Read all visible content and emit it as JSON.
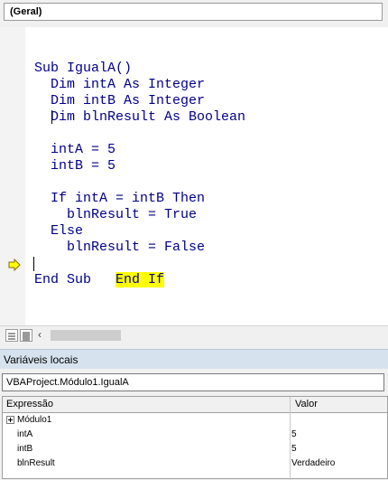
{
  "object_combo": {
    "value": "(Geral)"
  },
  "code": {
    "lines": [
      "Sub IgualA()",
      "  Dim intA As Integer",
      "  Dim intB As Integer",
      "  Dim blnResult As Boolean",
      "",
      "  intA = 5",
      "  intB = 5",
      "",
      "  If intA = intB Then",
      "    blnResult = True",
      "  Else",
      "    blnResult = False",
      "  End If",
      "End Sub"
    ],
    "current_line_index": 12
  },
  "locals": {
    "title": "Variáveis locais",
    "context": "VBAProject.Módulo1.IgualA",
    "columns": [
      "Expressão",
      "Valor"
    ],
    "rows": [
      {
        "name": "Módulo1",
        "value": ""
      },
      {
        "name": "intA",
        "value": "5"
      },
      {
        "name": "intB",
        "value": "5"
      },
      {
        "name": "blnResult",
        "value": "Verdadeiro"
      }
    ]
  },
  "colors": {
    "keyword": "#00008b",
    "highlight": "#ffff00",
    "execution_arrow": "#ffff00"
  },
  "icons": {
    "execution_arrow": "yellow-arrow-icon",
    "procedure_view": "procedure-view-icon",
    "module_view": "full-module-view-icon",
    "expand": "plus-box-icon"
  }
}
